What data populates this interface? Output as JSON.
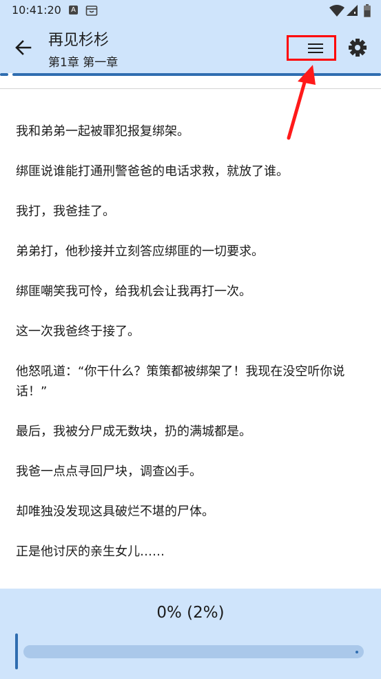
{
  "status_bar": {
    "time": "10:41:20",
    "notification_icon_letter": "A",
    "icons": [
      "a-notification-icon",
      "box-notification-icon",
      "wifi-icon",
      "signal-icon",
      "battery-icon"
    ]
  },
  "app_bar": {
    "book_title": "再见杉杉",
    "chapter_title": "第1章 第一章",
    "icons": [
      "back-arrow-icon",
      "menu-icon",
      "gear-icon"
    ],
    "background_color": "#cfe4fb",
    "accent_color": "#2f6db0",
    "highlight_color": "#ff0000"
  },
  "content": {
    "paragraphs": [
      "我和弟弟一起被罪犯报复绑架。",
      "绑匪说谁能打通刑警爸爸的电话求救，就放了谁。",
      "我打，我爸挂了。",
      "弟弟打，他秒接并立刻答应绑匪的一切要求。",
      "绑匪嘲笑我可怜，给我机会让我再打一次。",
      "这一次我爸终于接了。",
      "他怒吼道：“你干什么？策策都被绑架了！我现在没空听你说话！”",
      "最后，我被分尸成无数块，扔的满城都是。",
      "我爸一点点寻回尸块，调查凶手。",
      "却唯独没发现这具破烂不堪的尸体。",
      "正是他讨厌的亲生女儿……"
    ]
  },
  "bottom_panel": {
    "progress_label": "0% (2%)",
    "slider_value_percent": 0
  }
}
